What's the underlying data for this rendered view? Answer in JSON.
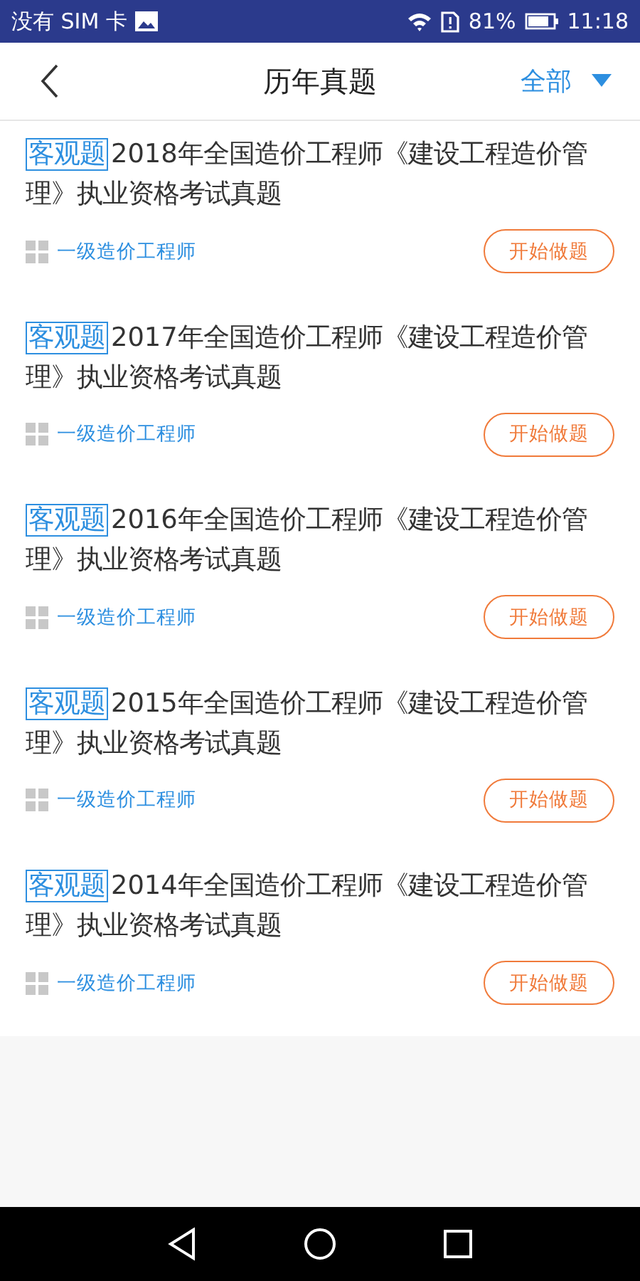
{
  "status_bar": {
    "carrier": "没有 SIM 卡",
    "battery": "81%",
    "time": "11:18"
  },
  "header": {
    "title": "历年真题",
    "filter": "全部"
  },
  "papers": [
    {
      "tag": "客观题",
      "title": "2018年全国造价工程师《建设工程造价管理》执业资格考试真题",
      "category": "一级造价工程师",
      "action": "开始做题"
    },
    {
      "tag": "客观题",
      "title": "2017年全国造价工程师《建设工程造价管理》执业资格考试真题",
      "category": "一级造价工程师",
      "action": "开始做题"
    },
    {
      "tag": "客观题",
      "title": "2016年全国造价工程师《建设工程造价管理》执业资格考试真题",
      "category": "一级造价工程师",
      "action": "开始做题"
    },
    {
      "tag": "客观题",
      "title": "2015年全国造价工程师《建设工程造价管理》执业资格考试真题",
      "category": "一级造价工程师",
      "action": "开始做题"
    },
    {
      "tag": "客观题",
      "title": "2014年全国造价工程师《建设工程造价管理》执业资格考试真题",
      "category": "一级造价工程师",
      "action": "开始做题"
    }
  ]
}
